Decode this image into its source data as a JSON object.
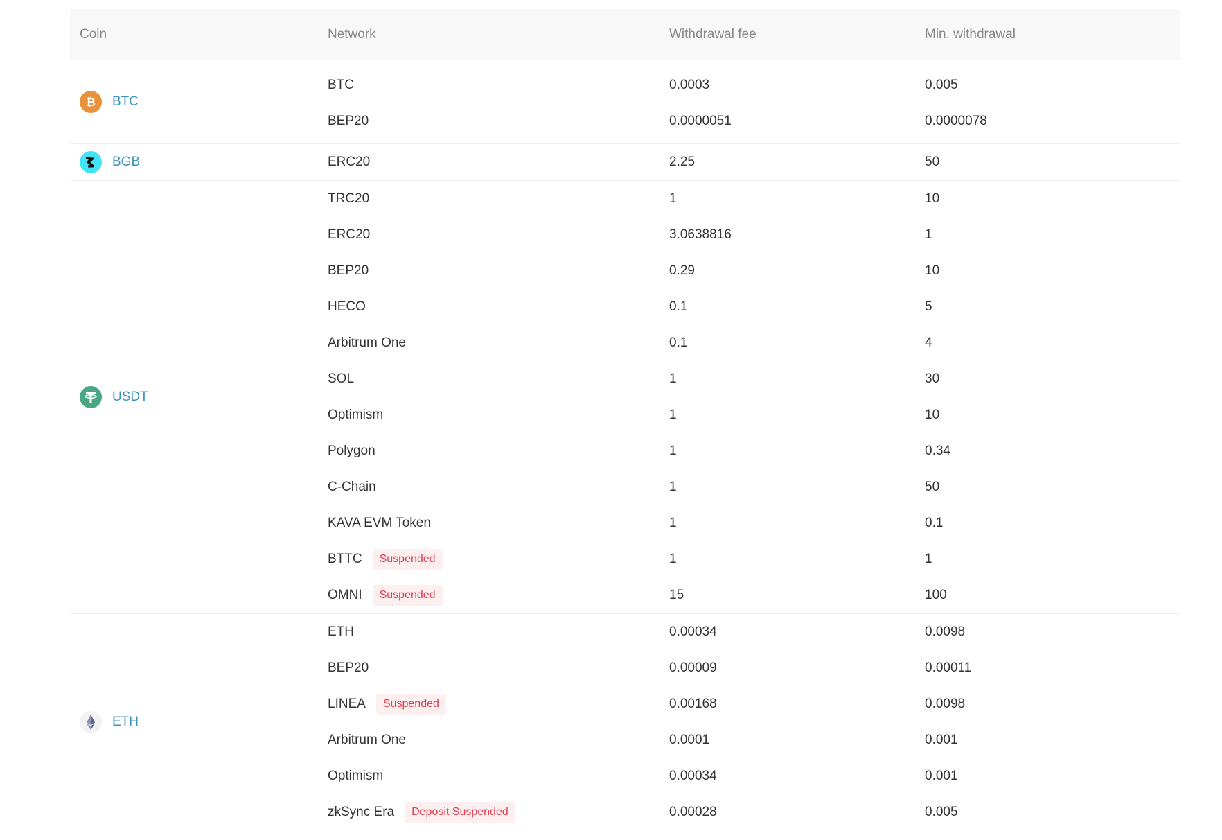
{
  "colors": {
    "header_bg": "#f8f8f8",
    "header_text": "#888888",
    "coin_link": "#3a93b8",
    "badge_bg": "#fdeef0",
    "badge_text": "#e23d4f",
    "btc": "#e8903a",
    "bgb": "#42e3f4",
    "usdt": "#4aa784",
    "eth": "#f2f2f4"
  },
  "header": {
    "coin": "Coin",
    "network": "Network",
    "withdrawal_fee": "Withdrawal fee",
    "min_withdrawal": "Min. withdrawal"
  },
  "coins": [
    {
      "symbol": "BTC",
      "icon": "bitcoin-icon",
      "networks": [
        {
          "network": "BTC",
          "fee": "0.0003",
          "min": "0.005",
          "badge": ""
        },
        {
          "network": "BEP20",
          "fee": "0.0000051",
          "min": "0.0000078",
          "badge": ""
        }
      ]
    },
    {
      "symbol": "BGB",
      "icon": "bitget-icon",
      "networks": [
        {
          "network": "ERC20",
          "fee": "2.25",
          "min": "50",
          "badge": ""
        }
      ]
    },
    {
      "symbol": "USDT",
      "icon": "tether-icon",
      "networks": [
        {
          "network": "TRC20",
          "fee": "1",
          "min": "10",
          "badge": ""
        },
        {
          "network": "ERC20",
          "fee": "3.0638816",
          "min": "1",
          "badge": ""
        },
        {
          "network": "BEP20",
          "fee": "0.29",
          "min": "10",
          "badge": ""
        },
        {
          "network": "HECO",
          "fee": "0.1",
          "min": "5",
          "badge": ""
        },
        {
          "network": "Arbitrum One",
          "fee": "0.1",
          "min": "4",
          "badge": ""
        },
        {
          "network": "SOL",
          "fee": "1",
          "min": "30",
          "badge": ""
        },
        {
          "network": "Optimism",
          "fee": "1",
          "min": "10",
          "badge": ""
        },
        {
          "network": "Polygon",
          "fee": "1",
          "min": "0.34",
          "badge": ""
        },
        {
          "network": "C-Chain",
          "fee": "1",
          "min": "50",
          "badge": ""
        },
        {
          "network": "KAVA EVM Token",
          "fee": "1",
          "min": "0.1",
          "badge": ""
        },
        {
          "network": "BTTC",
          "fee": "1",
          "min": "1",
          "badge": "Suspended"
        },
        {
          "network": "OMNI",
          "fee": "15",
          "min": "100",
          "badge": "Suspended"
        }
      ]
    },
    {
      "symbol": "ETH",
      "icon": "ethereum-icon",
      "networks": [
        {
          "network": "ETH",
          "fee": "0.00034",
          "min": "0.0098",
          "badge": ""
        },
        {
          "network": "BEP20",
          "fee": "0.00009",
          "min": "0.00011",
          "badge": ""
        },
        {
          "network": "LINEA",
          "fee": "0.00168",
          "min": "0.0098",
          "badge": "Suspended"
        },
        {
          "network": "Arbitrum One",
          "fee": "0.0001",
          "min": "0.001",
          "badge": ""
        },
        {
          "network": "Optimism",
          "fee": "0.00034",
          "min": "0.001",
          "badge": ""
        },
        {
          "network": "zkSync Era",
          "fee": "0.00028",
          "min": "0.005",
          "badge": "Deposit Suspended"
        }
      ]
    }
  ]
}
